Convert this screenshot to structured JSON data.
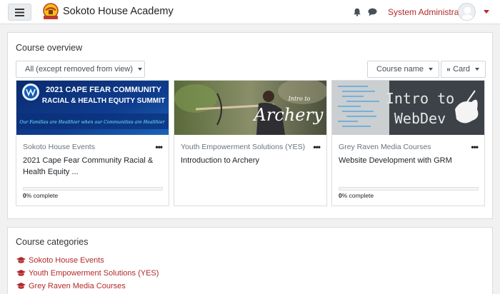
{
  "navbar": {
    "site_name": "Sokoto House Academy",
    "logo_text": "SOKOTO HOUSE",
    "user_name": "System Administrator",
    "icons": [
      "menu-icon",
      "notification-bell-icon",
      "messages-icon",
      "avatar-icon",
      "chevron-down-icon"
    ]
  },
  "overview": {
    "title": "Course overview",
    "filter_label": "All (except removed from view)",
    "sort_label": "Course name",
    "view_label": "Card",
    "courses": [
      {
        "category": "Sokoto House Events",
        "name": "2021 Cape Fear Community Racial & Health Equity ...",
        "image_title_line1": "2021 CAPE FEAR COMMUNITY",
        "image_title_line2": "RACIAL & HEALTH EQUITY SUMMIT",
        "image_tagline": "Our Families are Healthier when our Communities are Healthier",
        "progress_percent": 0,
        "progress_value": "0",
        "progress_suffix": "% complete"
      },
      {
        "category": "Youth Empowerment Solutions (YES)",
        "name": "Introduction to Archery",
        "image_text_small": "Intro to",
        "image_text_big": "Archery",
        "progress_percent": 0,
        "progress_value": "0",
        "progress_suffix": "% complete"
      },
      {
        "category": "Grey Raven Media Courses",
        "name": "Website Development with GRM",
        "image_text_line1": "Intro to",
        "image_text_line2": "WebDev",
        "progress_percent": 0,
        "progress_value": "0",
        "progress_suffix": "% complete"
      }
    ],
    "menu_glyph": "•••"
  },
  "categories": {
    "title": "Course categories",
    "items": [
      "Sokoto House Events",
      "Youth Empowerment Solutions (YES)",
      "Grey Raven Media Courses"
    ]
  },
  "colors": {
    "link": "#b32a2a",
    "progress": "#0f6cbf",
    "border": "#dcdcdc"
  }
}
